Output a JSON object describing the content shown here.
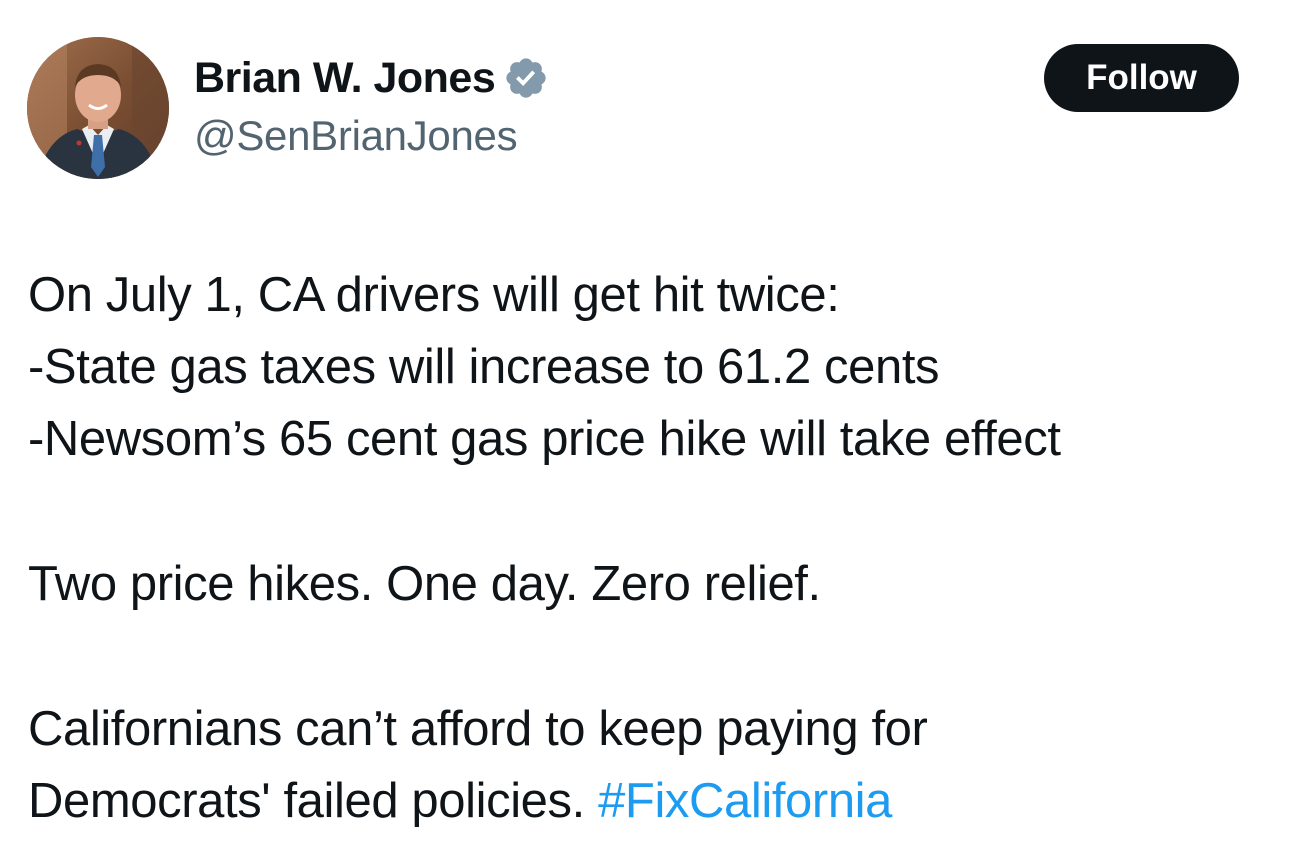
{
  "author": {
    "display_name": "Brian W. Jones",
    "handle": "@SenBrianJones",
    "verified_icon": "verified-badge-icon",
    "verified_color": "#829aab"
  },
  "actions": {
    "follow_label": "Follow"
  },
  "tweet": {
    "line1": "On July 1, CA drivers will get hit twice:",
    "line2": "-State gas taxes will increase to 61.2 cents",
    "line3": "-Newsom’s 65 cent gas price hike will take effect",
    "line4": "Two price hikes. One day. Zero relief.",
    "line5": "Californians can’t afford to keep paying for",
    "line6_text": "Democrats' failed policies. ",
    "hashtag": "#FixCalifornia"
  },
  "colors": {
    "text": "#0f1419",
    "secondary": "#536471",
    "link": "#1d9bf0",
    "button_bg": "#0f1419"
  }
}
